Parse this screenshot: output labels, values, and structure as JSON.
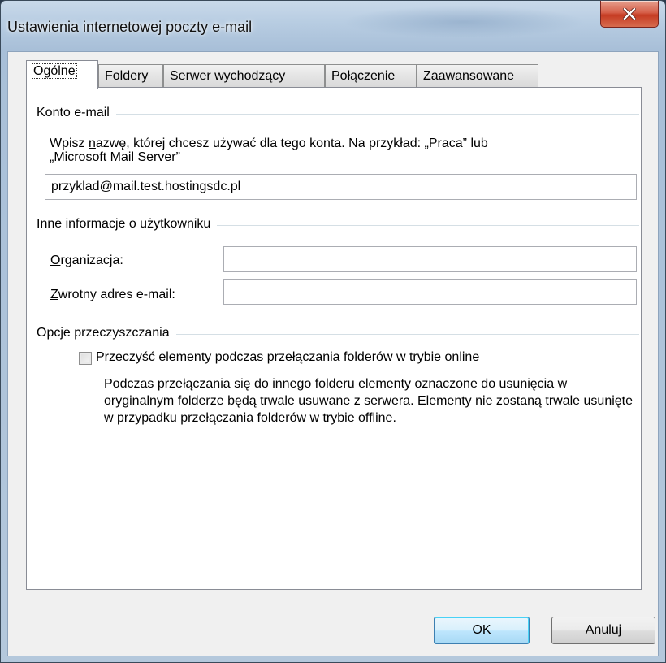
{
  "window": {
    "title": "Ustawienia internetowej poczty e-mail",
    "close_icon": "close-x-icon"
  },
  "tabs": [
    {
      "label": "Ogólne",
      "active": true
    },
    {
      "label": "Foldery",
      "active": false
    },
    {
      "label": "Serwer wychodzący",
      "active": false
    },
    {
      "label": "Połączenie",
      "active": false
    },
    {
      "label": "Zaawansowane",
      "active": false
    }
  ],
  "account": {
    "group_title": "Konto e-mail",
    "description_line1_pre": "Wpisz ",
    "description_underlined": "n",
    "description_line1_post": "azwę, której chcesz używać dla tego konta. Na przykład: „Praca” lub",
    "description_line2": "„Microsoft Mail Server”",
    "account_name_value": "przyklad@mail.test.hostingsdc.pl"
  },
  "user_info": {
    "group_title": "Inne informacje o użytkowniku",
    "organization_label_accel": "O",
    "organization_label_rest": "rganizacja:",
    "organization_value": "",
    "reply_label_accel": "Z",
    "reply_label_rest": "wrotny adres e-mail:",
    "reply_value": ""
  },
  "purge": {
    "group_title": "Opcje przeczyszczania",
    "checkbox_accel": "P",
    "checkbox_label_rest": "rzeczyść elementy podczas przełączania folderów w trybie online",
    "checked": false,
    "description": "Podczas przełączania się do innego folderu elementy oznaczone do usunięcia w oryginalnym folderze będą trwale usuwane z serwera. Elementy nie zostaną trwale usunięte w przypadku przełączania folderów w trybie offline."
  },
  "buttons": {
    "ok": "OK",
    "cancel": "Anuluj"
  }
}
